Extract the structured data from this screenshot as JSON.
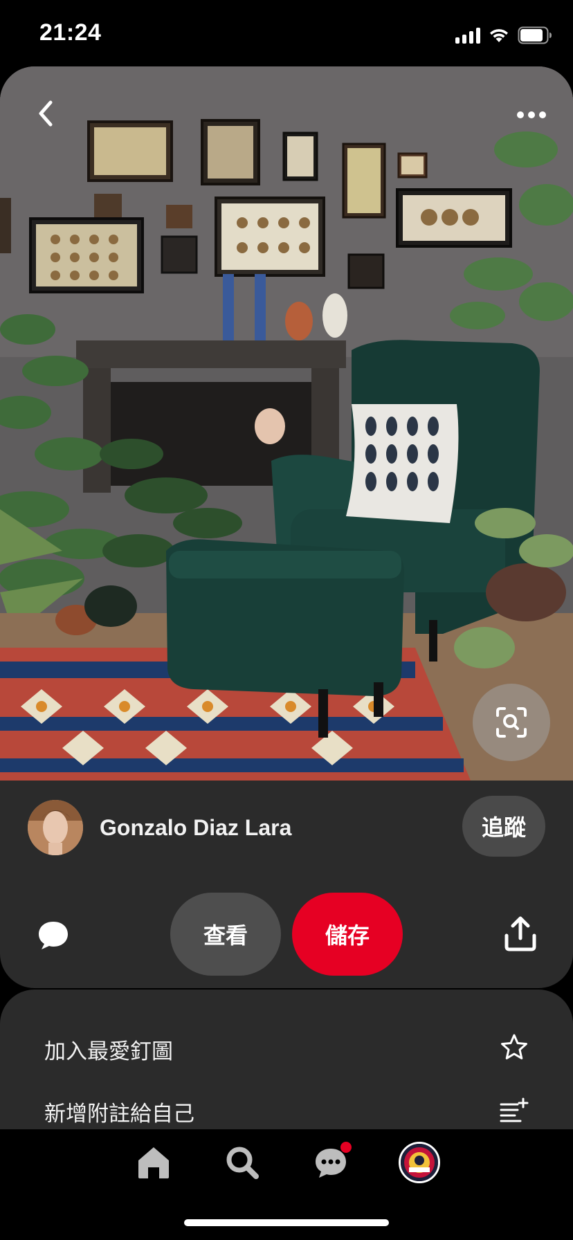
{
  "status_bar": {
    "time": "21:24"
  },
  "pin": {
    "image_icon": "photo",
    "back_icon": "chevron-left-icon",
    "more_icon": "ellipsis-icon",
    "lens_icon": "visual-search-icon"
  },
  "author": {
    "name": "Gonzalo Diaz Lara",
    "follow_label": "追蹤"
  },
  "actions": {
    "view_label": "查看",
    "save_label": "儲存"
  },
  "options": [
    {
      "label": "加入最愛釘圖",
      "icon": "star-icon"
    },
    {
      "label": "新增附註給自己",
      "icon": "add-note-icon"
    }
  ],
  "bottom_nav": {
    "items": [
      "home-icon",
      "search-icon",
      "messages-icon",
      "profile-avatar"
    ],
    "messages_has_notification": true
  },
  "colors": {
    "accent": "#e60023",
    "card_bg": "#2b2b2b",
    "button_gray": "#4e4e4e"
  }
}
